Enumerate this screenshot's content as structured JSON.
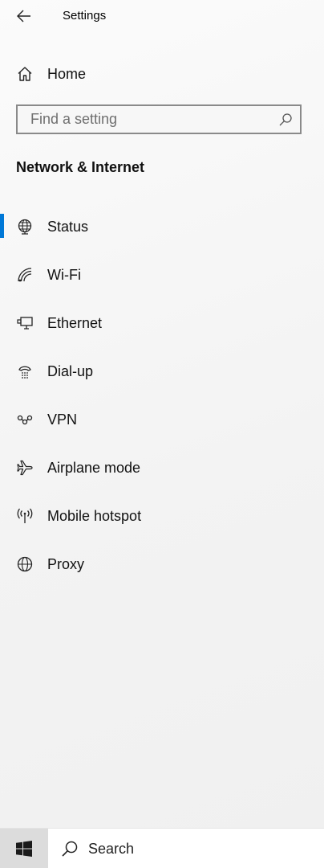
{
  "window": {
    "title": "Settings",
    "back_icon": "back-arrow-icon"
  },
  "home": {
    "label": "Home",
    "icon": "home-icon"
  },
  "search": {
    "placeholder": "Find a setting",
    "icon": "search-icon"
  },
  "section": {
    "title": "Network & Internet"
  },
  "nav": {
    "selected_index": 0,
    "accent_color": "#0078d7",
    "items": [
      {
        "label": "Status",
        "icon": "globe-status-icon"
      },
      {
        "label": "Wi-Fi",
        "icon": "wifi-icon"
      },
      {
        "label": "Ethernet",
        "icon": "ethernet-icon"
      },
      {
        "label": "Dial-up",
        "icon": "dial-up-icon"
      },
      {
        "label": "VPN",
        "icon": "vpn-icon"
      },
      {
        "label": "Airplane mode",
        "icon": "airplane-icon"
      },
      {
        "label": "Mobile hotspot",
        "icon": "hotspot-icon"
      },
      {
        "label": "Proxy",
        "icon": "globe-icon"
      }
    ]
  },
  "taskbar": {
    "start_icon": "windows-logo-icon",
    "search_label": "Search",
    "search_icon": "search-icon"
  }
}
